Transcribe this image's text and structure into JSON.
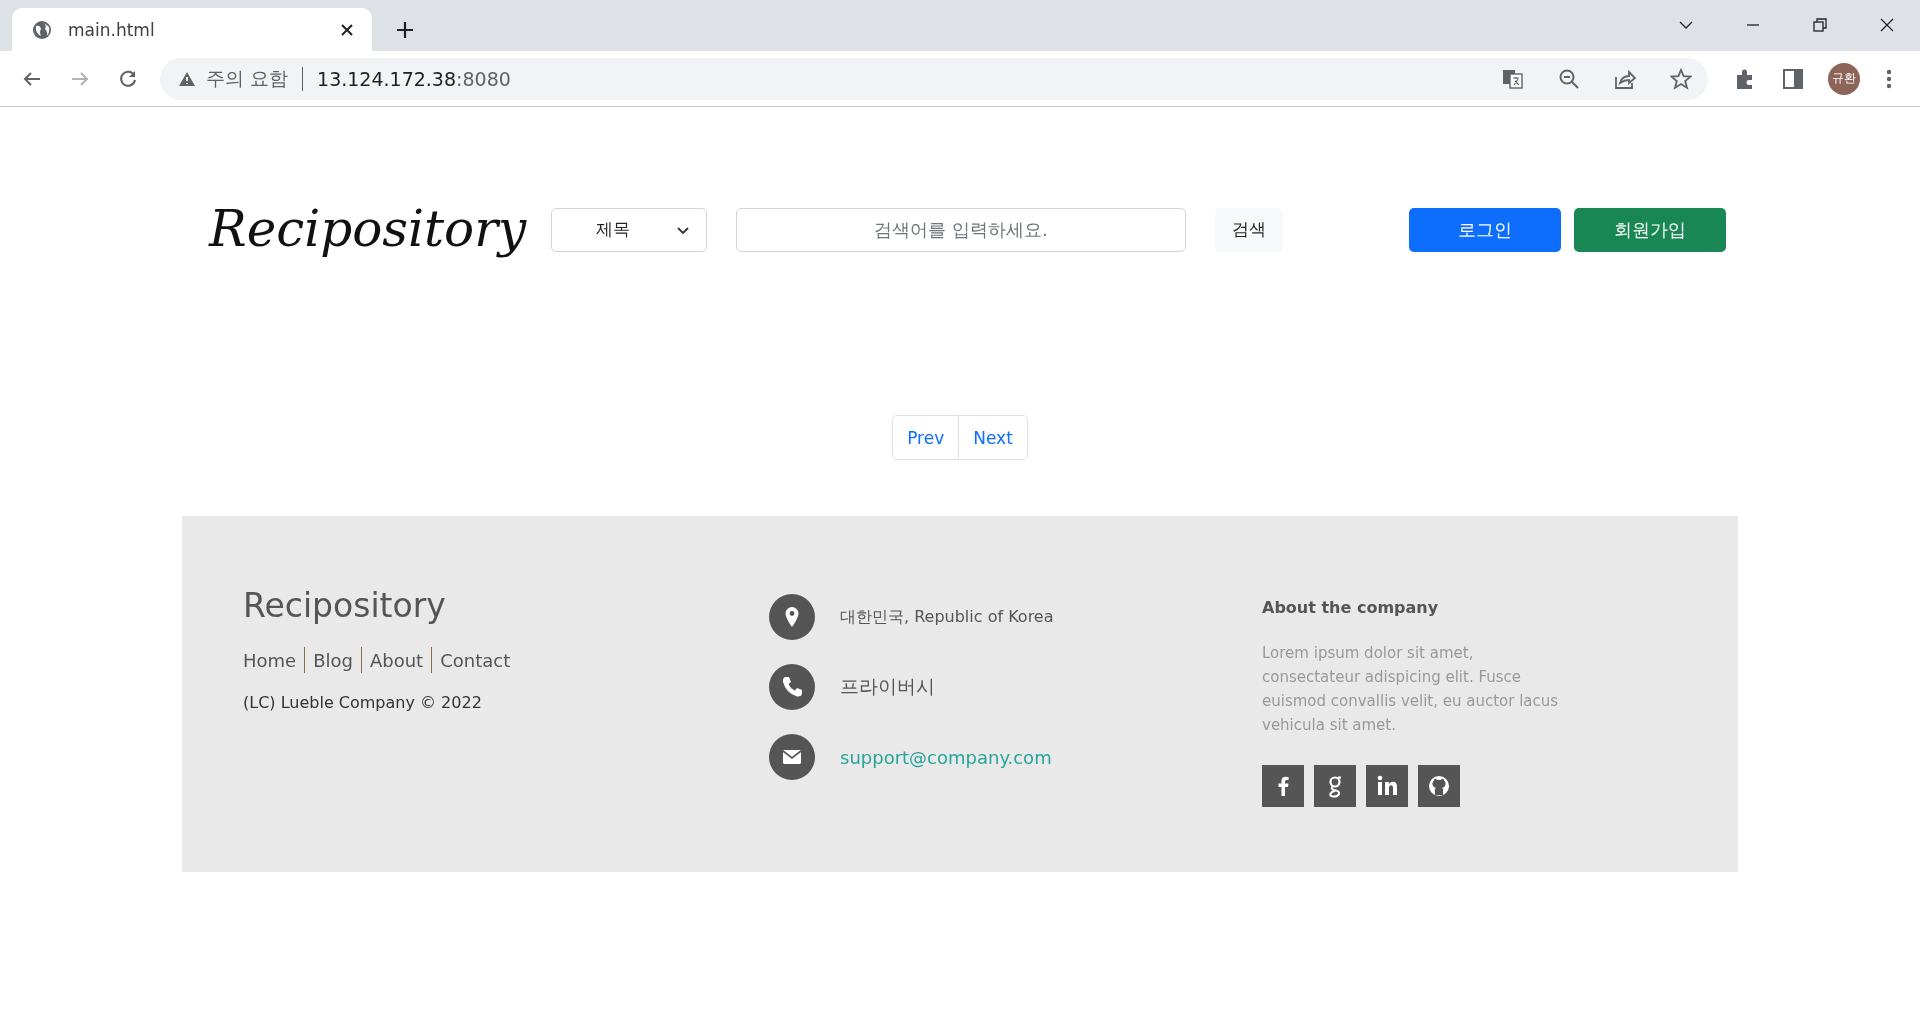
{
  "browser": {
    "tab_title": "main.html",
    "security_label": "주의 요함",
    "url_host": "13.124.172.38",
    "url_port": ":8080",
    "profile_initials": "규환"
  },
  "header": {
    "logo": "Recipository",
    "search_type": "제목",
    "search_placeholder": "검색어를 입력하세요.",
    "search_button": "검색",
    "login_button": "로그인",
    "signup_button": "회원가입"
  },
  "pagination": [
    "Prev",
    "Next"
  ],
  "footer": {
    "brand": "Recipository",
    "links": [
      "Home",
      "Blog",
      "About",
      "Contact"
    ],
    "copyright": "(LC) Lueble Company © 2022",
    "contacts": [
      {
        "kind": "location",
        "text": "대한민국, Republic of Korea"
      },
      {
        "kind": "phone",
        "text": "프라이버시"
      },
      {
        "kind": "email",
        "text": "support@company.com"
      }
    ],
    "about_title": "About the company",
    "about_text": "Lorem ipsum dolor sit amet, consectateur adispicing elit. Fusce euismod convallis velit, eu auctor lacus vehicula sit amet.",
    "social": [
      {
        "kind": "facebook"
      },
      {
        "kind": "google"
      },
      {
        "kind": "linkedin"
      },
      {
        "kind": "github"
      }
    ]
  }
}
